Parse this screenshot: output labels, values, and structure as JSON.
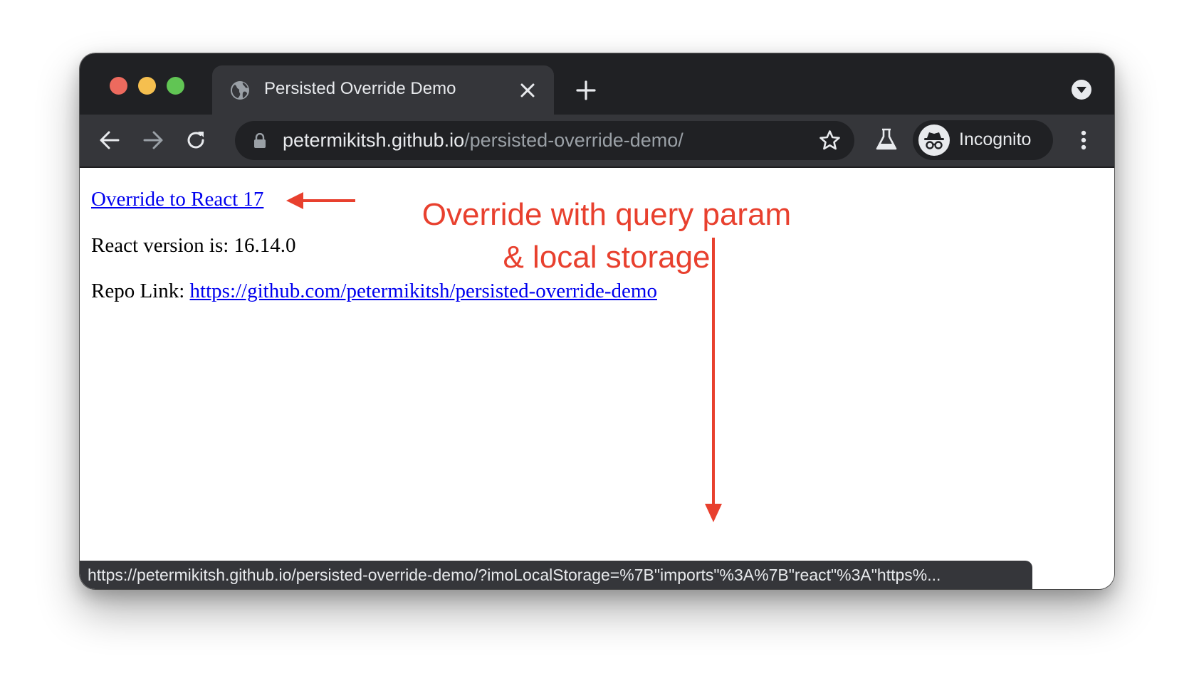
{
  "browser": {
    "tab": {
      "title": "Persisted Override Demo"
    },
    "address_bar": {
      "host": "petermikitsh.github.io",
      "path": "/persisted-override-demo/"
    },
    "profile": {
      "label": "Incognito"
    },
    "status_url": "https://petermikitsh.github.io/persisted-override-demo/?imoLocalStorage=%7B\"imports\"%3A%7B\"react\"%3A\"https%..."
  },
  "page": {
    "override_link": "Override to React 17",
    "version_text": "React version is: 16.14.0",
    "repo_label": "Repo Link:",
    "repo_link": "https://github.com/petermikitsh/persisted-override-demo"
  },
  "annotation": {
    "text": "Override with query param\n& local storage",
    "color": "#e8402e"
  },
  "colors": {
    "titlebar": "#202124",
    "toolbar": "#35363a",
    "link": "#0000ee",
    "traffic_red": "#ed6a5e",
    "traffic_yellow": "#f5bf4f",
    "traffic_green": "#61c554"
  },
  "icons": [
    "globe-icon",
    "close-icon",
    "plus-icon",
    "tab-search-icon",
    "back-arrow-icon",
    "forward-arrow-icon",
    "reload-icon",
    "lock-icon",
    "star-icon",
    "labs-flask-icon",
    "incognito-icon",
    "more-menu-icon"
  ]
}
